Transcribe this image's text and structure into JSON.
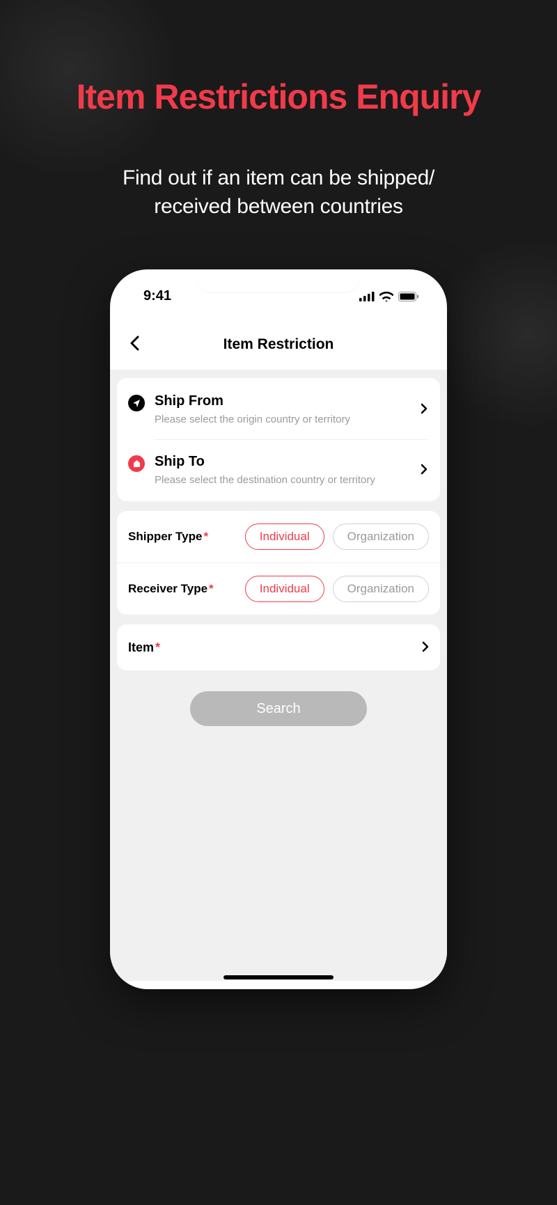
{
  "hero": {
    "title": "Item Restrictions Enquiry",
    "subtitle_line1": "Find out if an item can be shipped/",
    "subtitle_line2": "received between countries"
  },
  "status": {
    "time": "9:41"
  },
  "nav": {
    "title": "Item Restriction"
  },
  "ship": {
    "from_label": "Ship From",
    "from_hint": "Please select the origin country or territory",
    "to_label": "Ship To",
    "to_hint": "Please select the destination country or territory"
  },
  "types": {
    "shipper_label": "Shipper Type",
    "receiver_label": "Receiver Type",
    "required_mark": "*",
    "option_individual": "Individual",
    "option_organization": "Organization"
  },
  "item": {
    "label": "Item",
    "required_mark": "*"
  },
  "actions": {
    "search": "Search"
  }
}
